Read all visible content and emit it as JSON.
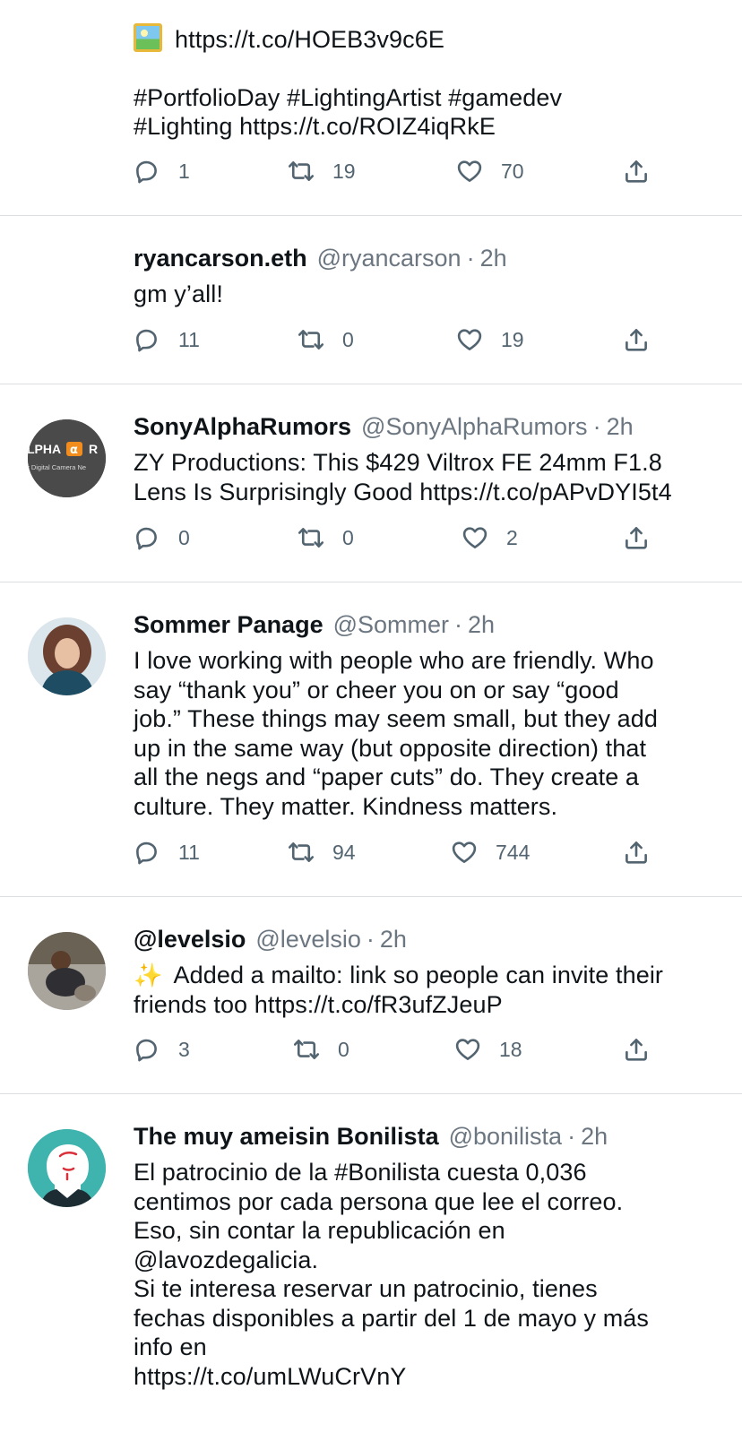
{
  "tweets": [
    {
      "id": "t1",
      "name": "",
      "handle": "",
      "time": "",
      "link_line": "https://t.co/HOEB3v9c6E",
      "body": "#PortfolioDay #LightingArtist #gamedev\n#Lighting https://t.co/ROIZ4iqRkE",
      "replies": "1",
      "retweets": "19",
      "likes": "70"
    },
    {
      "id": "t2",
      "name": "ryancarson.eth",
      "handle": "@ryancarson",
      "time": "2h",
      "body": "gm y’all!",
      "replies": "11",
      "retweets": "0",
      "likes": "19"
    },
    {
      "id": "t3",
      "name": "SonyAlphaRumors",
      "handle": "@SonyAlphaRumors",
      "time": "2h",
      "avatar_text": "LPHA",
      "avatar_text2": "y Digital Camera Ne",
      "body": "ZY Productions: This $429 Viltrox FE 24mm F1.8\nLens Is Surprisingly Good https://t.co/pAPvDYI5t4",
      "replies": "0",
      "retweets": "0",
      "likes": "2"
    },
    {
      "id": "t4",
      "name": "Sommer Panage",
      "handle": "@Sommer",
      "time": "2h",
      "body": "I love working with people who are friendly. Who\nsay “thank you” or cheer you on or say “good\njob.” These things may seem small, but they add\nup in the same way (but opposite direction) that\nall the negs and “paper cuts” do. They create a\nculture. They matter. Kindness matters.",
      "replies": "11",
      "retweets": "94",
      "likes": "744"
    },
    {
      "id": "t5",
      "name": "@levelsio",
      "handle": "@levelsio",
      "time": "2h",
      "sparkle": "✨",
      "body": "Added a mailto: link so people can invite their\nfriends too https://t.co/fR3ufZJeuP",
      "replies": "3",
      "retweets": "0",
      "likes": "18"
    },
    {
      "id": "t6",
      "name": "The muy ameisin Bonilista",
      "handle": "@bonilista",
      "time": "2h",
      "body": "El patrocinio de la #Bonilista cuesta 0,036\ncentimos por cada persona que lee el correo.\nEso, sin contar la republicación en\n@lavozdegalicia.\nSi te interesa reservar un patrocinio, tienes\nfechas disponibles a partir del 1 de mayo y más\ninfo en\nhttps://t.co/umLWuCrVnY"
    }
  ],
  "separator": "·",
  "colors": {
    "text": "#0f1419",
    "secondary": "#6b7680",
    "divider": "#dcdfe2",
    "icon": "#536471"
  }
}
